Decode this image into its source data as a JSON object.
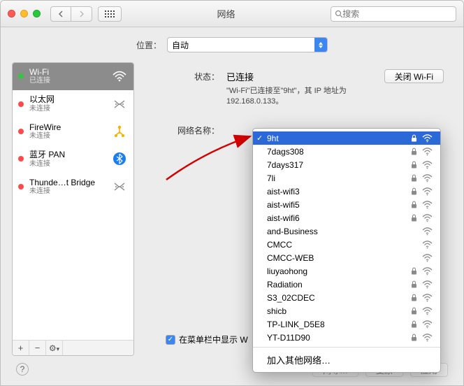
{
  "titlebar": {
    "title": "网络",
    "search_placeholder": "搜索"
  },
  "location_row": {
    "label": "位置：",
    "value": "自动"
  },
  "sidebar": {
    "items": [
      {
        "name": "Wi-Fi",
        "status": "已连接",
        "dot": "green",
        "icon": "wifi",
        "selected": true
      },
      {
        "name": "以太网",
        "status": "未连接",
        "dot": "red",
        "icon": "eth"
      },
      {
        "name": "FireWire",
        "status": "未连接",
        "dot": "red",
        "icon": "firewire"
      },
      {
        "name": "蓝牙 PAN",
        "status": "未连接",
        "dot": "red",
        "icon": "bt"
      },
      {
        "name": "Thunde…t Bridge",
        "status": "未连接",
        "dot": "red",
        "icon": "eth"
      }
    ]
  },
  "main": {
    "status_label": "状态：",
    "status_value": "已连接",
    "turn_off_btn": "关闭 Wi-Fi",
    "status_desc": "\"Wi-Fi\"已连接至\"9ht\"，其 IP 地址为 192.168.0.133。",
    "network_name_label": "网络名称：",
    "show_menu_checkbox": "在菜单栏中显示 W"
  },
  "dropdown": {
    "items": [
      {
        "name": "9ht",
        "locked": true,
        "selected": true
      },
      {
        "name": "7dags308",
        "locked": true
      },
      {
        "name": "7days317",
        "locked": true
      },
      {
        "name": "7li",
        "locked": true
      },
      {
        "name": "aist-wifi3",
        "locked": true
      },
      {
        "name": "aist-wifi5",
        "locked": true
      },
      {
        "name": "aist-wifi6",
        "locked": true
      },
      {
        "name": "and-Business",
        "locked": false
      },
      {
        "name": "CMCC",
        "locked": false
      },
      {
        "name": "CMCC-WEB",
        "locked": false
      },
      {
        "name": "liuyaohong",
        "locked": true
      },
      {
        "name": "Radiation",
        "locked": true
      },
      {
        "name": "S3_02CDEC",
        "locked": true
      },
      {
        "name": "shicb",
        "locked": true
      },
      {
        "name": "TP-LINK_D5E8",
        "locked": true
      },
      {
        "name": "YT-D11D90",
        "locked": true
      }
    ],
    "other_label": "加入其他网络…"
  },
  "footer": {
    "cancel": "复原",
    "apply": "应用",
    "help_label": "网导…"
  }
}
